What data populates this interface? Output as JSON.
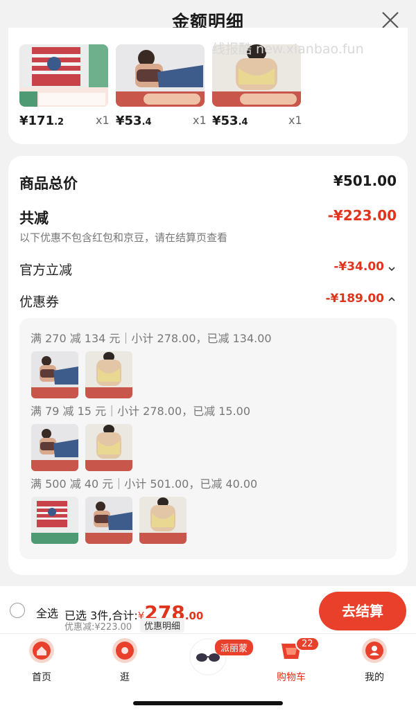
{
  "header": {
    "title": "金额明细",
    "watermark": "线报酷 new.xianbao.fun"
  },
  "products": [
    {
      "price_int": "¥171",
      "price_dec": ".2",
      "qty": "x1",
      "icon": "sweater-product"
    },
    {
      "price_int": "¥53",
      "price_dec": ".4",
      "qty": "x1",
      "icon": "bra-brown-product"
    },
    {
      "price_int": "¥53",
      "price_dec": ".4",
      "qty": "x1",
      "icon": "bra-beige-product"
    }
  ],
  "summary": {
    "total_label": "商品总价",
    "total_value": "¥501.00",
    "reduce_label": "共减",
    "reduce_value": "-¥223.00",
    "reduce_note": "以下优惠不包含红包和京豆，请在结算页查看",
    "official_label": "官方立减",
    "official_value": "-¥34.00",
    "coupon_label": "优惠券",
    "coupon_value": "-¥189.00"
  },
  "coupon_groups": [
    {
      "title": "满 270 减 134 元｜小计 278.00，已减 134.00",
      "items": [
        "bra-brown-thumb",
        "bra-beige-thumb"
      ]
    },
    {
      "title": "满 79 减 15 元｜小计 278.00，已减 15.00",
      "items": [
        "bra-brown-thumb",
        "bra-beige-thumb"
      ]
    },
    {
      "title": "满 500 减 40 元｜小计 501.00，已减 40.00",
      "items": [
        "sweater-thumb",
        "bra-brown-thumb",
        "bra-beige-thumb"
      ]
    }
  ],
  "bottom": {
    "select_all": "全选",
    "selected_text": "已选 3件,合计:",
    "currency": "¥",
    "total_int": "278",
    "total_dec": ".00",
    "discount_text": "优惠减:¥223.00",
    "detail_chip": "优惠明细",
    "checkout": "去结算"
  },
  "tabs": [
    {
      "label": "首页",
      "icon": "home-icon"
    },
    {
      "label": "逛",
      "icon": "browse-icon"
    },
    {
      "label": "",
      "icon": "brand-glasses-icon",
      "pill": "派丽蒙"
    },
    {
      "label": "购物车",
      "icon": "cart-icon",
      "badge": "22"
    },
    {
      "label": "我的",
      "icon": "profile-icon"
    }
  ],
  "colors": {
    "accent": "#e8402a",
    "price_red": "#e0341d"
  }
}
